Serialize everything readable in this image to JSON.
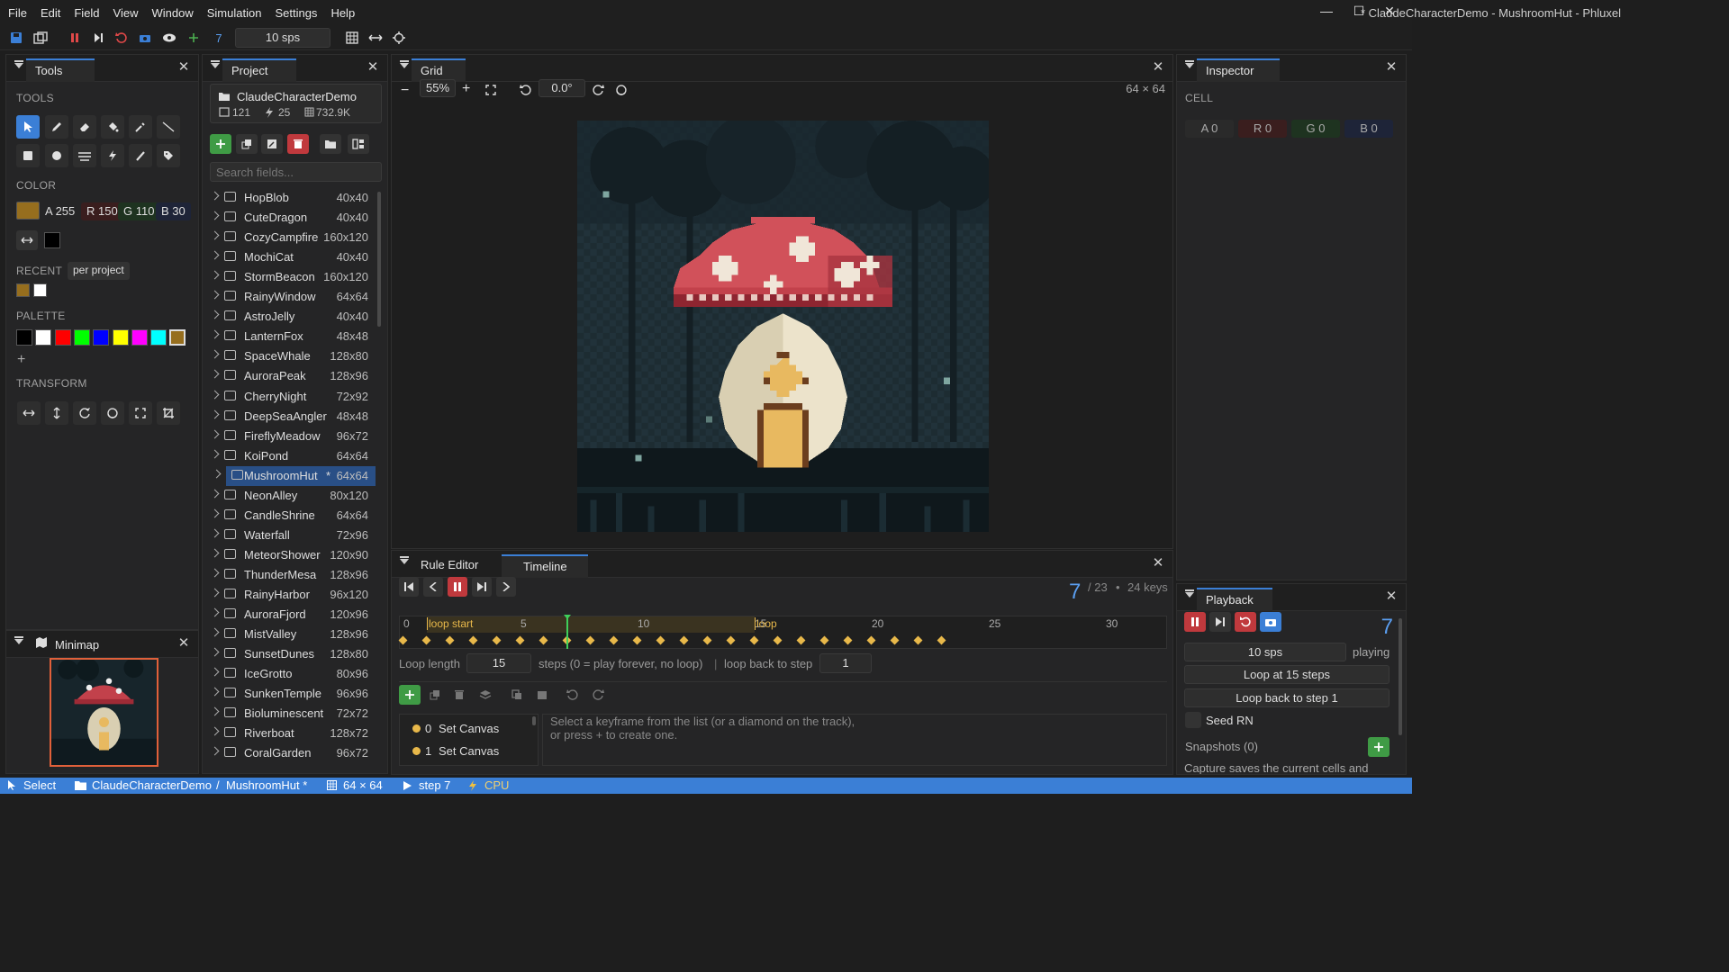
{
  "menu": [
    "File",
    "Edit",
    "Field",
    "View",
    "Window",
    "Simulation",
    "Settings",
    "Help"
  ],
  "window_title": "* ClaudeCharacterDemo - MushroomHut - Phluxel",
  "toolbar": {
    "step": "7",
    "speed": "10 sps"
  },
  "tools": {
    "tab": "Tools",
    "tools_label": "TOOLS",
    "color_label": "COLOR",
    "color": {
      "a": "A 255",
      "r": "R 150",
      "g": "G 110",
      "b": "B 30",
      "hex": "#966e1e"
    },
    "recent_label": "RECENT",
    "recent_scope": "per project",
    "palette_label": "PALETTE",
    "palette": [
      "#000000",
      "#ffffff",
      "#ff0000",
      "#00ff00",
      "#0000ff",
      "#ffff00",
      "#ff00ff",
      "#00ffff",
      "#966e1e"
    ],
    "transform_label": "TRANSFORM"
  },
  "minimap": {
    "tab": "Minimap"
  },
  "project": {
    "tab": "Project",
    "name": "ClaudeCharacterDemo",
    "stats": {
      "images": "121",
      "rules": "25",
      "size": "732.9K"
    },
    "search_placeholder": "Search fields...",
    "fields": [
      {
        "name": "HopBlob",
        "dim": "40x40"
      },
      {
        "name": "CuteDragon",
        "dim": "40x40"
      },
      {
        "name": "CozyCampfire",
        "dim": "160x120"
      },
      {
        "name": "MochiCat",
        "dim": "40x40"
      },
      {
        "name": "StormBeacon",
        "dim": "160x120"
      },
      {
        "name": "RainyWindow",
        "dim": "64x64"
      },
      {
        "name": "AstroJelly",
        "dim": "40x40"
      },
      {
        "name": "LanternFox",
        "dim": "48x48"
      },
      {
        "name": "SpaceWhale",
        "dim": "128x80"
      },
      {
        "name": "AuroraPeak",
        "dim": "128x96"
      },
      {
        "name": "CherryNight",
        "dim": "72x92"
      },
      {
        "name": "DeepSeaAngler",
        "dim": "48x48"
      },
      {
        "name": "FireflyMeadow",
        "dim": "96x72"
      },
      {
        "name": "KoiPond",
        "dim": "64x64"
      },
      {
        "name": "MushroomHut",
        "dim": "64x64",
        "selected": true,
        "modified": "*"
      },
      {
        "name": "NeonAlley",
        "dim": "80x120"
      },
      {
        "name": "CandleShrine",
        "dim": "64x64"
      },
      {
        "name": "Waterfall",
        "dim": "72x96"
      },
      {
        "name": "MeteorShower",
        "dim": "120x90"
      },
      {
        "name": "ThunderMesa",
        "dim": "128x96"
      },
      {
        "name": "RainyHarbor",
        "dim": "96x120"
      },
      {
        "name": "AuroraFjord",
        "dim": "120x96"
      },
      {
        "name": "MistValley",
        "dim": "128x96"
      },
      {
        "name": "SunsetDunes",
        "dim": "128x80"
      },
      {
        "name": "IceGrotto",
        "dim": "80x96"
      },
      {
        "name": "SunkenTemple",
        "dim": "96x96"
      },
      {
        "name": "Bioluminescent",
        "dim": "72x72"
      },
      {
        "name": "Riverboat",
        "dim": "128x72"
      },
      {
        "name": "CoralGarden",
        "dim": "96x72"
      }
    ]
  },
  "grid": {
    "tab": "Grid",
    "zoom": "55%",
    "rotation": "0.0°",
    "size": "64 × 64"
  },
  "timeline": {
    "tabs": [
      "Rule Editor",
      "Timeline"
    ],
    "current_step": "7",
    "total": "/ 23",
    "separator": "•",
    "keys": "24 keys",
    "ruler": [
      "0",
      "5",
      "10",
      "15",
      "20",
      "25",
      "30"
    ],
    "loop_start_label": "loop start",
    "loop_label": "loop",
    "loop_length_label": "Loop length",
    "loop_length": "15",
    "steps_hint": "steps (0 = play forever, no loop)",
    "divider": "|",
    "loop_back_label": "loop back to step",
    "loop_back": "1",
    "keyframes": [
      {
        "idx": "0",
        "label": "Set Canvas"
      },
      {
        "idx": "1",
        "label": "Set Canvas"
      }
    ],
    "hint": "Select a keyframe from the list (or a diamond on the track),",
    "hint2": "or press + to create one."
  },
  "inspector": {
    "tab": "Inspector",
    "cell_label": "CELL",
    "a": "A 0",
    "r": "R 0",
    "g": "G 0",
    "b": "B 0"
  },
  "playback": {
    "tab": "Playback",
    "step": "7",
    "speed": "10 sps",
    "state": "playing",
    "loop_at": "Loop at 15 steps",
    "loop_back": "Loop back to step 1",
    "seed": "Seed RN",
    "snapshots": "Snapshots (0)",
    "capture_hint": "Capture saves the current cells and"
  },
  "status": {
    "tool": "Select",
    "project": "ClaudeCharacterDemo",
    "sep": "/",
    "field": "MushroomHut *",
    "size": "64 × 64",
    "step": "step 7",
    "backend": "CPU"
  }
}
